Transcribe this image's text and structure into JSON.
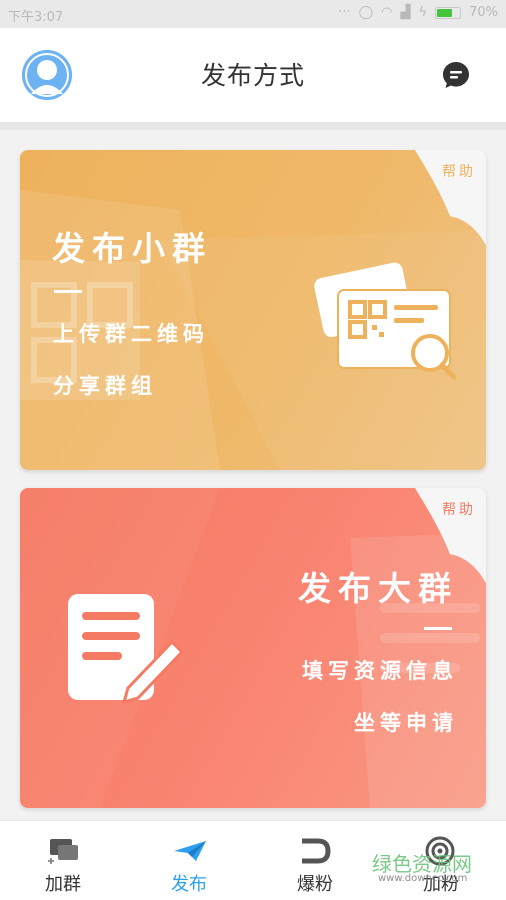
{
  "status_bar": {
    "time": "下午3:07",
    "battery": "70%",
    "battery_level": 0.7
  },
  "header": {
    "title": "发布方式",
    "avatar_icon": "user-avatar-icon",
    "message_icon": "message-icon"
  },
  "cards": {
    "small": {
      "title": "发布小群",
      "help": "帮助",
      "line1": "上传群二维码",
      "line2": "分享群组",
      "icon": "qr-card-search-icon"
    },
    "big": {
      "title": "发布大群",
      "help": "帮助",
      "line1": "填写资源信息",
      "line2": "坐等申请",
      "icon": "document-edit-icon"
    }
  },
  "bottom_nav": [
    {
      "label": "加群",
      "icon": "chat-add-icon",
      "active": false
    },
    {
      "label": "发布",
      "icon": "paper-plane-icon",
      "active": true
    },
    {
      "label": "爆粉",
      "icon": "magnet-icon",
      "active": false
    },
    {
      "label": "加粉",
      "icon": "target-icon",
      "active": false
    }
  ],
  "watermark": {
    "text": "绿色资源网",
    "url_text": "www.downcc.com"
  },
  "colors": {
    "accent": "#2d9ff0",
    "card_small": "#eeb25c",
    "card_big": "#f57a63"
  }
}
